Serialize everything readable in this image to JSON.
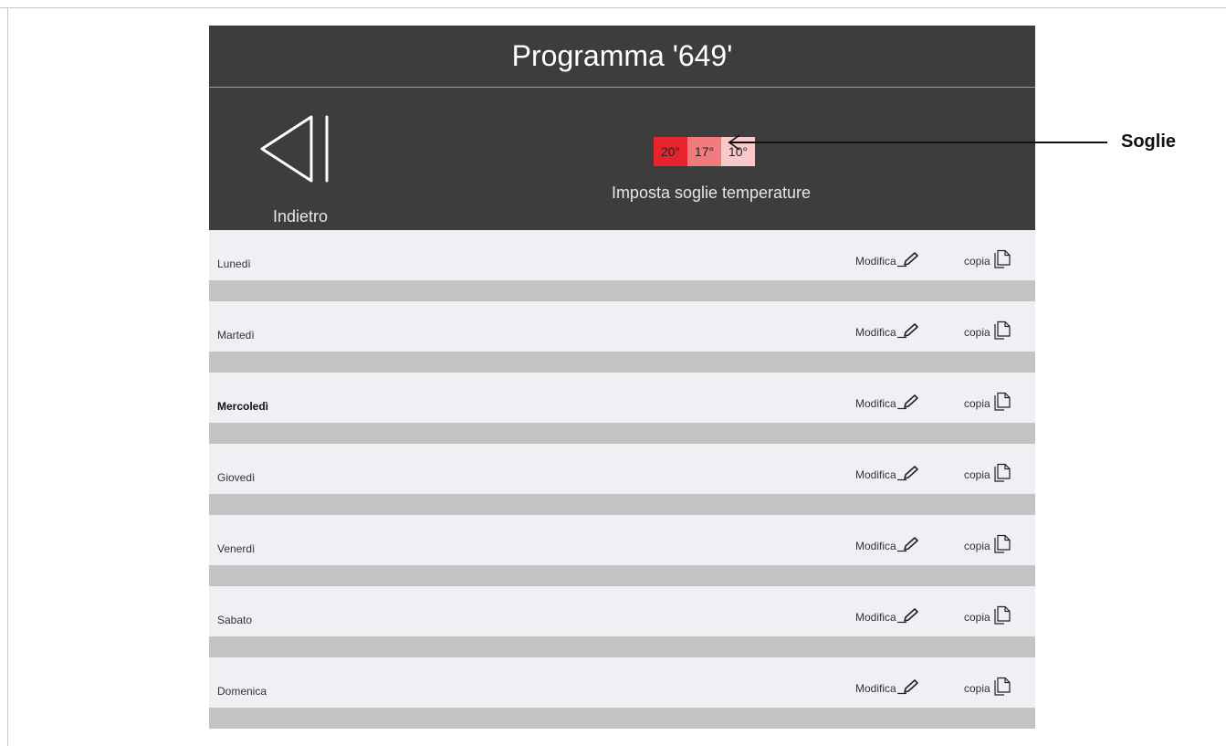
{
  "header": {
    "title": "Programma '649'"
  },
  "toolbar": {
    "back_label": "Indietro",
    "thresholds_label": "Imposta soglie temperature",
    "thresholds": [
      {
        "value": "20°",
        "color": "#e8232a"
      },
      {
        "value": "17°",
        "color": "#f07a7d"
      },
      {
        "value": "10°",
        "color": "#f9c8c8"
      }
    ]
  },
  "days": [
    {
      "name": "Lunedì",
      "bold": false
    },
    {
      "name": "Martedì",
      "bold": false
    },
    {
      "name": "Mercoledì",
      "bold": true
    },
    {
      "name": "Giovedì",
      "bold": false
    },
    {
      "name": "Venerdì",
      "bold": false
    },
    {
      "name": "Sabato",
      "bold": false
    },
    {
      "name": "Domenica",
      "bold": false
    }
  ],
  "actions": {
    "edit_label": "Modifica",
    "copy_label": "copia"
  },
  "annotation": {
    "label": "Soglie"
  },
  "colors": {
    "dark_bg": "#3d3d3d",
    "row_bg": "#f0f0f4",
    "separator": "#c3c3c3"
  }
}
